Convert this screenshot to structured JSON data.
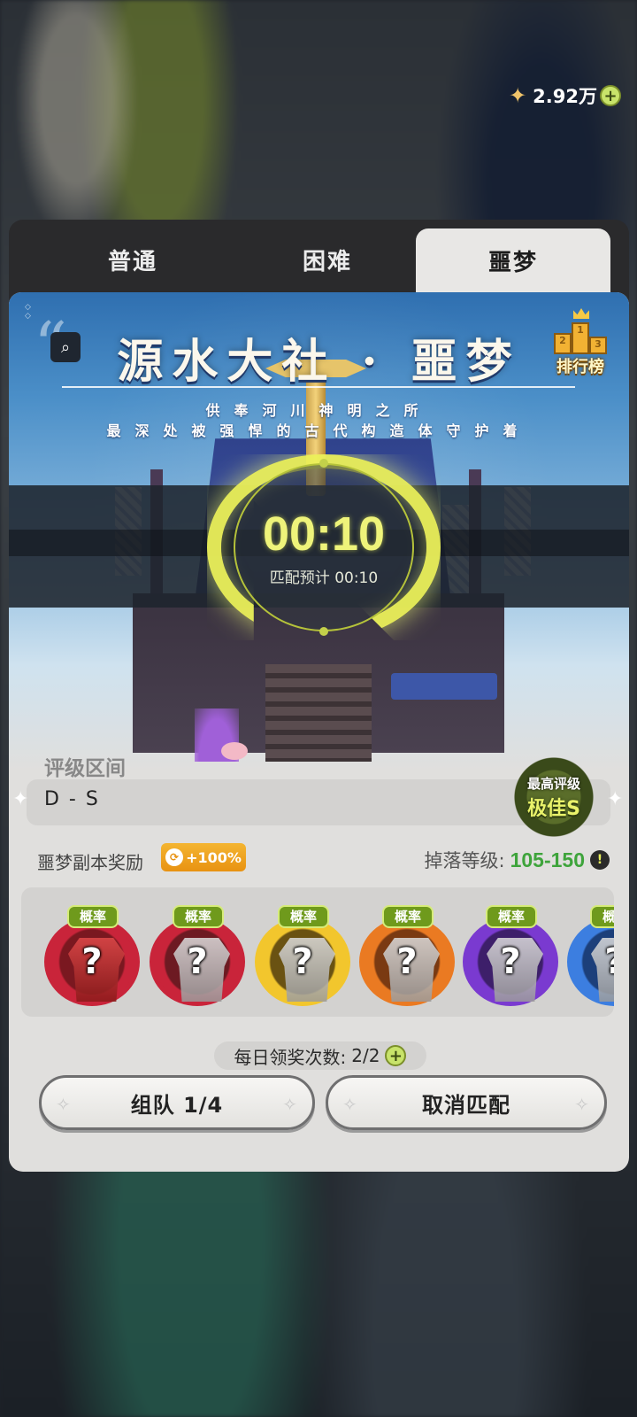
{
  "currency": {
    "icon": "crystal-star-icon",
    "amount": "2.92万",
    "add_icon": "plus-icon"
  },
  "tabs": [
    {
      "label": "普通",
      "active": false
    },
    {
      "label": "困难",
      "active": false
    },
    {
      "label": "噩梦",
      "active": true
    }
  ],
  "dungeon": {
    "title": "源水大社 · 噩梦",
    "subtitle_line1": "供奉河川神明之所",
    "subtitle_line2": "最深处被强悍的古代构造体守护着",
    "ranking_label": "排行榜",
    "podium": [
      "2",
      "1",
      "3"
    ]
  },
  "matching": {
    "timer": "00:10",
    "estimate": "匹配预计 00:10"
  },
  "grade": {
    "label": "评级区间",
    "value": "D - S",
    "best_label": "最高评级",
    "best_value": "极佳S"
  },
  "rewards": {
    "title": "噩梦副本奖励",
    "bonus": "+100%",
    "drop_label": "掉落等级:",
    "drop_value": "105-150",
    "items": [
      {
        "tag": "概率",
        "ring": "#c9243a",
        "inner": "#7a1820",
        "icon": "red-gear-icon"
      },
      {
        "tag": "概率",
        "ring": "#c9243a",
        "inner": "#6d1a22",
        "icon": "armor-icon"
      },
      {
        "tag": "概率",
        "ring": "#f2c62d",
        "inner": "#6a5212",
        "icon": "armor-icon"
      },
      {
        "tag": "概率",
        "ring": "#ea7a22",
        "inner": "#7a3a12",
        "icon": "armor-icon"
      },
      {
        "tag": "概率",
        "ring": "#7a3ad0",
        "inner": "#3d1f6a",
        "icon": "armor-icon"
      },
      {
        "tag": "概率",
        "ring": "#3c7ee0",
        "inner": "#1c3f7a",
        "icon": "armor-icon"
      }
    ]
  },
  "daily": {
    "label": "每日领奖次数:",
    "value": "2/2"
  },
  "buttons": {
    "team": "组队 1/4",
    "cancel": "取消匹配"
  }
}
